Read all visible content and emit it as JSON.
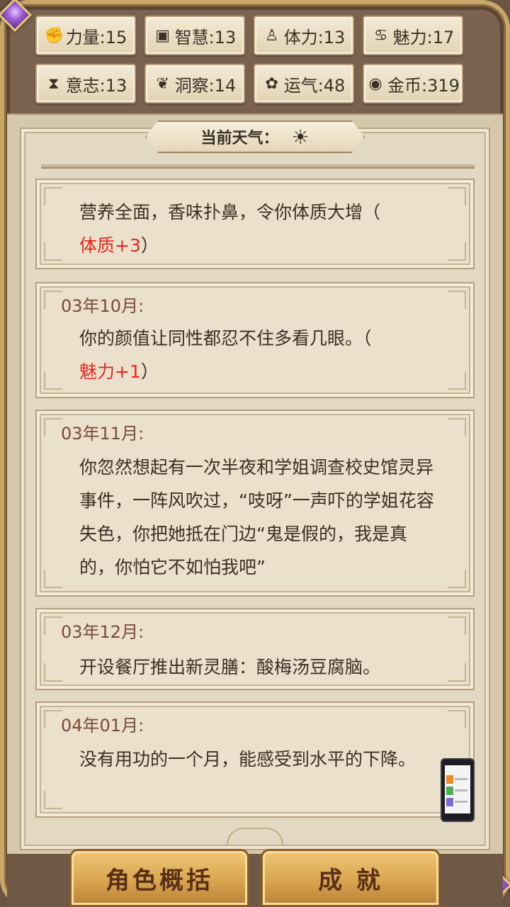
{
  "stats": [
    {
      "icon": "fist-icon",
      "glyph": "✊",
      "label": "力量:15"
    },
    {
      "icon": "book-icon",
      "glyph": "▣",
      "label": "智慧:13"
    },
    {
      "icon": "person-icon",
      "glyph": "♙",
      "label": "体力:13"
    },
    {
      "icon": "charm-icon",
      "glyph": "♋",
      "label": "魅力:17"
    },
    {
      "icon": "hourglass-icon",
      "glyph": "⧗",
      "label": "意志:13"
    },
    {
      "icon": "wing-icon",
      "glyph": "❦",
      "label": "洞察:14"
    },
    {
      "icon": "clover-icon",
      "glyph": "✿",
      "label": "运气:48"
    },
    {
      "icon": "coin-icon",
      "glyph": "◉",
      "label": "金币:319"
    }
  ],
  "weather": {
    "label": "当前天气：",
    "icon": "sun-icon",
    "glyph": "☀"
  },
  "entries": [
    {
      "date": "",
      "text": "营养全面，香味扑鼻，令你体质大增（",
      "bonus": "体质+3",
      "tail": "）"
    },
    {
      "date": "03年10月:",
      "text": "你的颜值让同性都忍不住多看几眼。（",
      "bonus": "魅力+1",
      "tail": "）"
    },
    {
      "date": "03年11月:",
      "text": "你忽然想起有一次半夜和学姐调查校史馆灵异事件，一阵风吹过，“吱呀”一声吓的学姐花容失色，你把她抵在门边“鬼是假的，我是真的，你怕它不如怕我吧”",
      "bonus": "",
      "tail": ""
    },
    {
      "date": "03年12月:",
      "text": "开设餐厅推出新灵膳：酸梅汤豆腐脑。",
      "bonus": "",
      "tail": ""
    },
    {
      "date": "04年01月:",
      "text": "没有用功的一个月，能感受到水平的下降。",
      "bonus": "",
      "tail": ""
    }
  ],
  "buttons": {
    "overview": "角色概括",
    "achievements": "成 就"
  }
}
